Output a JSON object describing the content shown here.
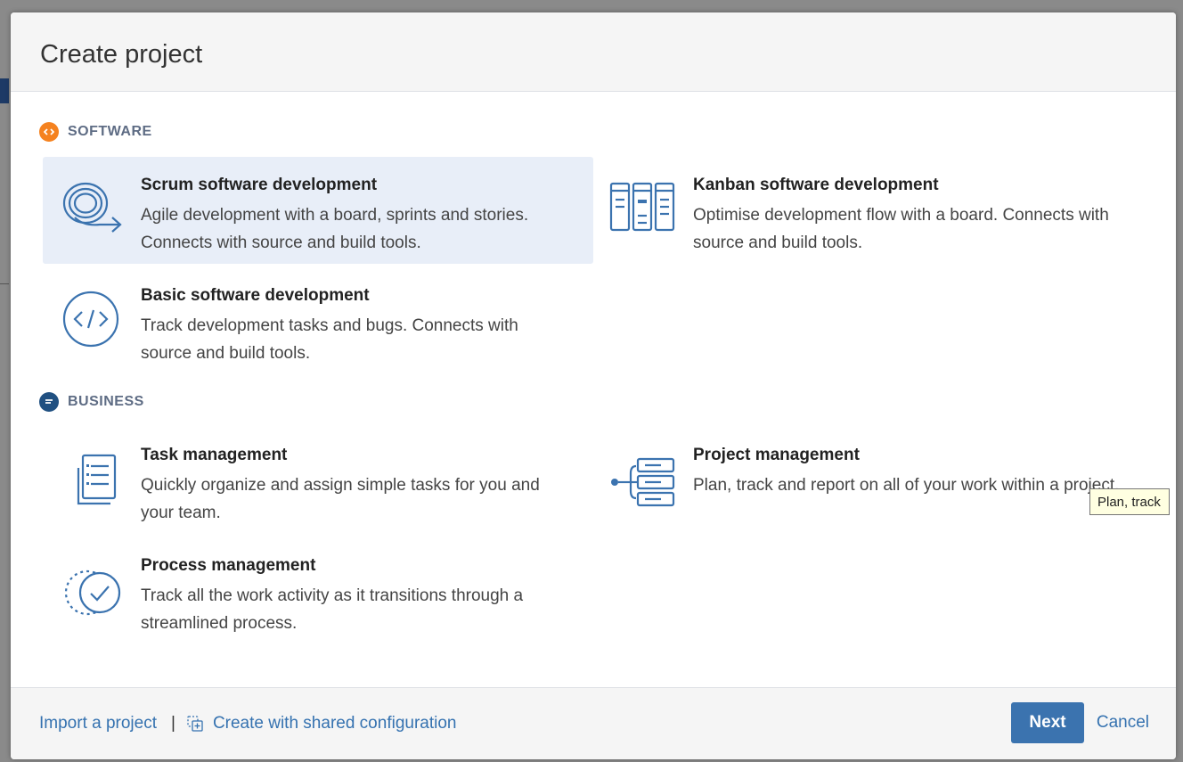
{
  "dialog": {
    "title": "Create project"
  },
  "sections": {
    "software": {
      "label": "SOFTWARE",
      "icon": "code-circle-icon",
      "color": "#f5821f",
      "tiles": [
        {
          "title": "Scrum software development",
          "description": "Agile development with a board, sprints and stories. Connects with source and build tools.",
          "icon": "scrum-cycle-icon",
          "selected": true
        },
        {
          "title": "Kanban software development",
          "description": "Optimise development flow with a board. Connects with source and build tools.",
          "icon": "kanban-board-icon",
          "selected": false
        },
        {
          "title": "Basic software development",
          "description": "Track development tasks and bugs. Connects with source and build tools.",
          "icon": "code-brackets-icon",
          "selected": false
        }
      ]
    },
    "business": {
      "label": "BUSINESS",
      "icon": "chat-circle-icon",
      "color": "#205081",
      "tiles": [
        {
          "title": "Task management",
          "description": "Quickly organize and assign simple tasks for you and your team.",
          "icon": "task-list-icon",
          "selected": false
        },
        {
          "title": "Project management",
          "description": "Plan, track and report on all of your work within a project.",
          "icon": "project-tree-icon",
          "selected": false
        },
        {
          "title": "Process management",
          "description": "Track all the work activity as it transitions through a streamlined process.",
          "icon": "process-check-icon",
          "selected": false
        }
      ]
    }
  },
  "tooltip": {
    "text": "Plan, track"
  },
  "footer": {
    "import_label": "Import a project",
    "separator": "|",
    "shared_config_label": "Create with shared configuration",
    "next_label": "Next",
    "cancel_label": "Cancel"
  },
  "colors": {
    "accent": "#3b73af",
    "link": "#3572b0",
    "selected_tile": "#e8eef8",
    "icon_stroke": "#3b73af"
  }
}
